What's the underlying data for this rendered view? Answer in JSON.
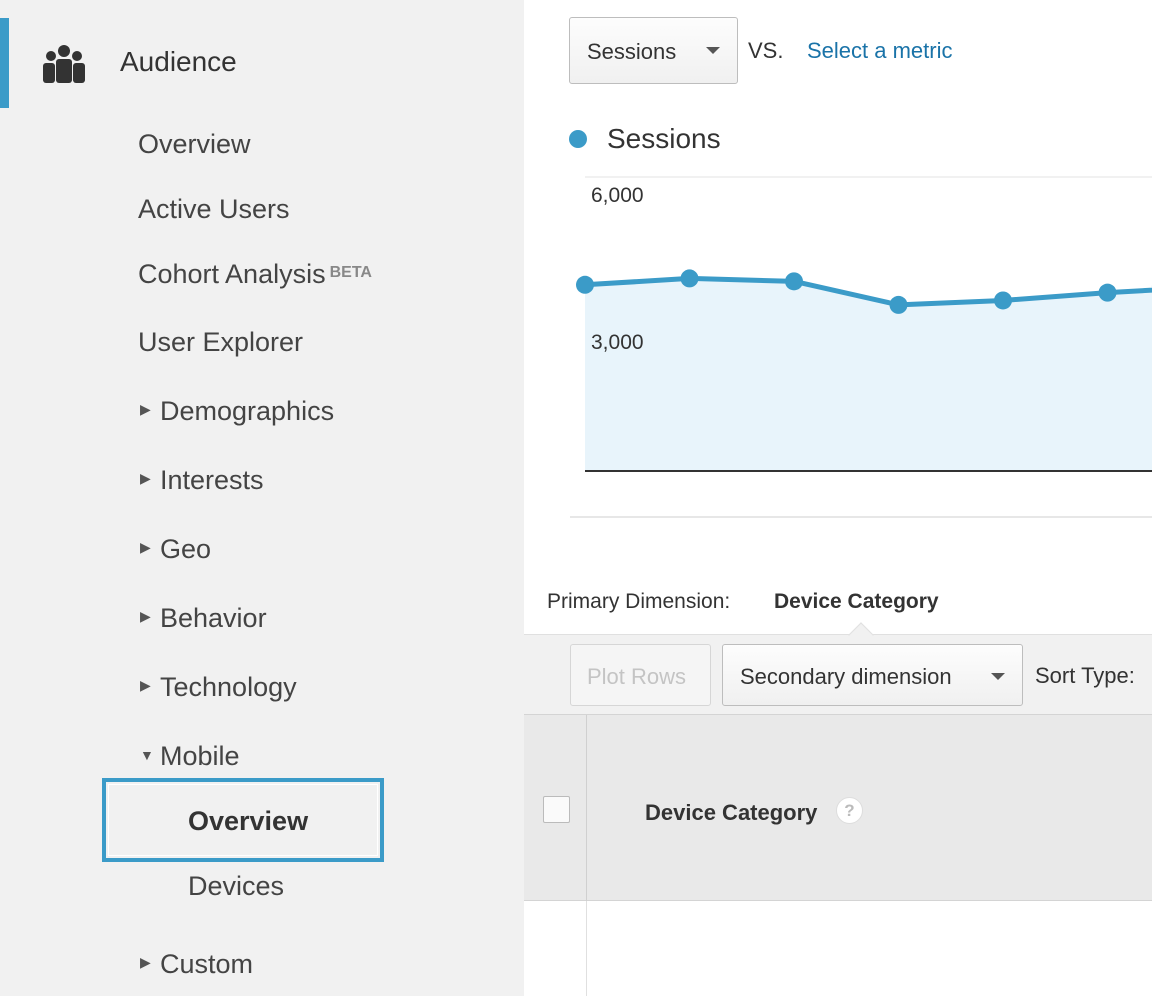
{
  "sidebar": {
    "section": {
      "title": "Audience",
      "icon": "audience-group-icon"
    },
    "items": [
      {
        "label": "Overview"
      },
      {
        "label": "Active Users"
      },
      {
        "label": "Cohort Analysis",
        "badge": "BETA"
      },
      {
        "label": "User Explorer"
      },
      {
        "label": "Demographics",
        "expandable": true
      },
      {
        "label": "Interests",
        "expandable": true
      },
      {
        "label": "Geo",
        "expandable": true
      },
      {
        "label": "Behavior",
        "expandable": true
      },
      {
        "label": "Technology",
        "expandable": true
      },
      {
        "label": "Mobile",
        "expanded": true,
        "children": [
          {
            "label": "Overview",
            "active": true
          },
          {
            "label": "Devices"
          }
        ]
      },
      {
        "label": "Custom",
        "expandable": true
      }
    ],
    "accent_color": "#3b9bc8"
  },
  "metric_picker": {
    "selected": "Sessions",
    "vs_label": "VS.",
    "compare_link": "Select a metric"
  },
  "chart_data": {
    "type": "area",
    "series": [
      {
        "name": "Sessions",
        "color": "#3b9bc8",
        "values": [
          3800,
          3930,
          3870,
          3390,
          3480,
          3640,
          3760
        ]
      }
    ],
    "yticks": [
      "6,000",
      "3,000"
    ],
    "ylim": [
      0,
      6000
    ],
    "grid": true,
    "legend": "top-left"
  },
  "primary_dimension": {
    "label": "Primary Dimension:",
    "value": "Device Category"
  },
  "toolbar": {
    "plot_rows": "Plot Rows",
    "secondary_dimension": "Secondary dimension",
    "sort_type": "Sort Type:"
  },
  "table": {
    "columns": [
      {
        "label": "Device Category",
        "help": "?"
      }
    ]
  }
}
